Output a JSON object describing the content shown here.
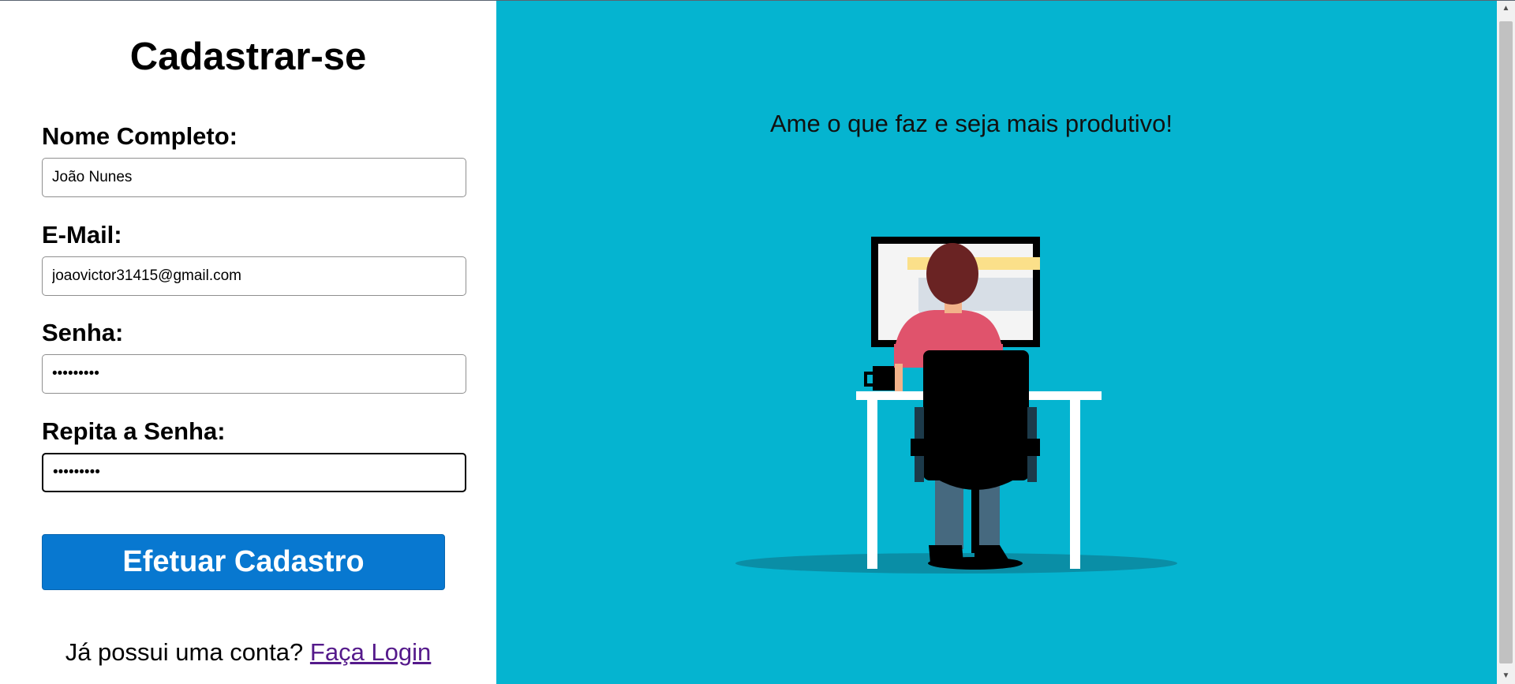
{
  "form": {
    "title": "Cadastrar-se",
    "fields": [
      {
        "label": "Nome Completo:",
        "value": "João Nunes",
        "type": "text"
      },
      {
        "label": "E-Mail:",
        "value": "joaovictor31415@gmail.com",
        "type": "text"
      },
      {
        "label": "Senha:",
        "value": "•••••••••",
        "type": "password"
      },
      {
        "label": "Repita a Senha:",
        "value": "•••••••••",
        "type": "password"
      }
    ],
    "submit_label": "Efetuar Cadastro",
    "login_prompt": "Já possui uma conta?",
    "login_link": "Faça Login"
  },
  "hero": {
    "tagline": "Ame o que faz e seja mais produtivo!",
    "illustration": "person-working-at-computer-illustration"
  },
  "colors": {
    "accent_button": "#0878d0",
    "hero_background": "#05b4d0",
    "link": "#551a8b"
  }
}
